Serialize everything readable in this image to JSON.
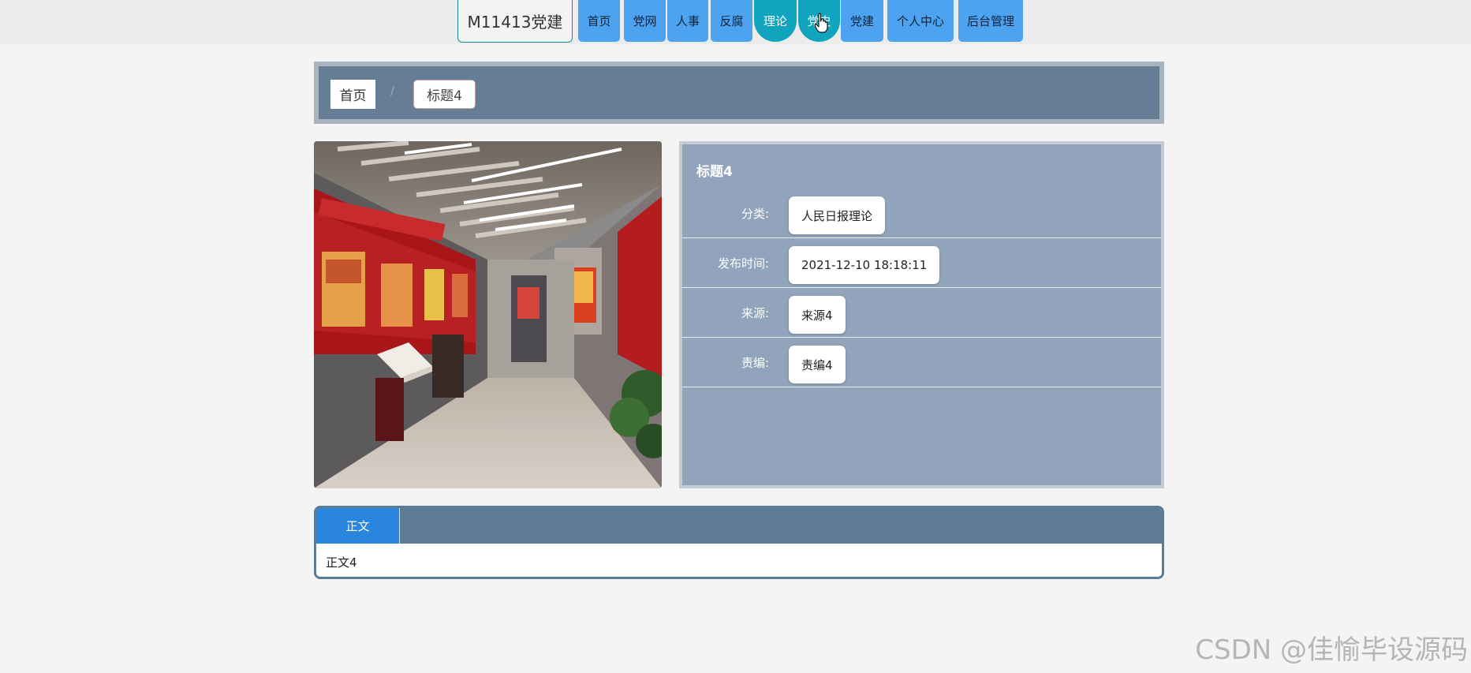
{
  "nav": {
    "brand": "M11413党建",
    "items": [
      {
        "label": "首页"
      },
      {
        "label": "党网"
      },
      {
        "label": "人事"
      },
      {
        "label": "反腐"
      },
      {
        "label": "理论"
      },
      {
        "label": "党史"
      },
      {
        "label": "党建"
      },
      {
        "label": "个人中心"
      },
      {
        "label": "后台管理"
      }
    ]
  },
  "breadcrumb": {
    "home": "首页",
    "separator": "/",
    "current": "标题4"
  },
  "detail": {
    "title": "标题4",
    "fields": [
      {
        "label": "分类:",
        "value": "人民日报理论"
      },
      {
        "label": "发布时间:",
        "value": "2021-12-10 18:18:11"
      },
      {
        "label": "来源:",
        "value": "来源4"
      },
      {
        "label": "责编:",
        "value": "责编4"
      }
    ]
  },
  "content": {
    "tab_label": "正文",
    "body": "正文4"
  },
  "watermark": "CSDN @佳愉毕设源码",
  "colors": {
    "nav_item": "#4da3f0",
    "nav_active": "#11a4bf",
    "panel": "#657e96",
    "info_panel": "#91a4bb",
    "tab_active": "#2a85de"
  }
}
